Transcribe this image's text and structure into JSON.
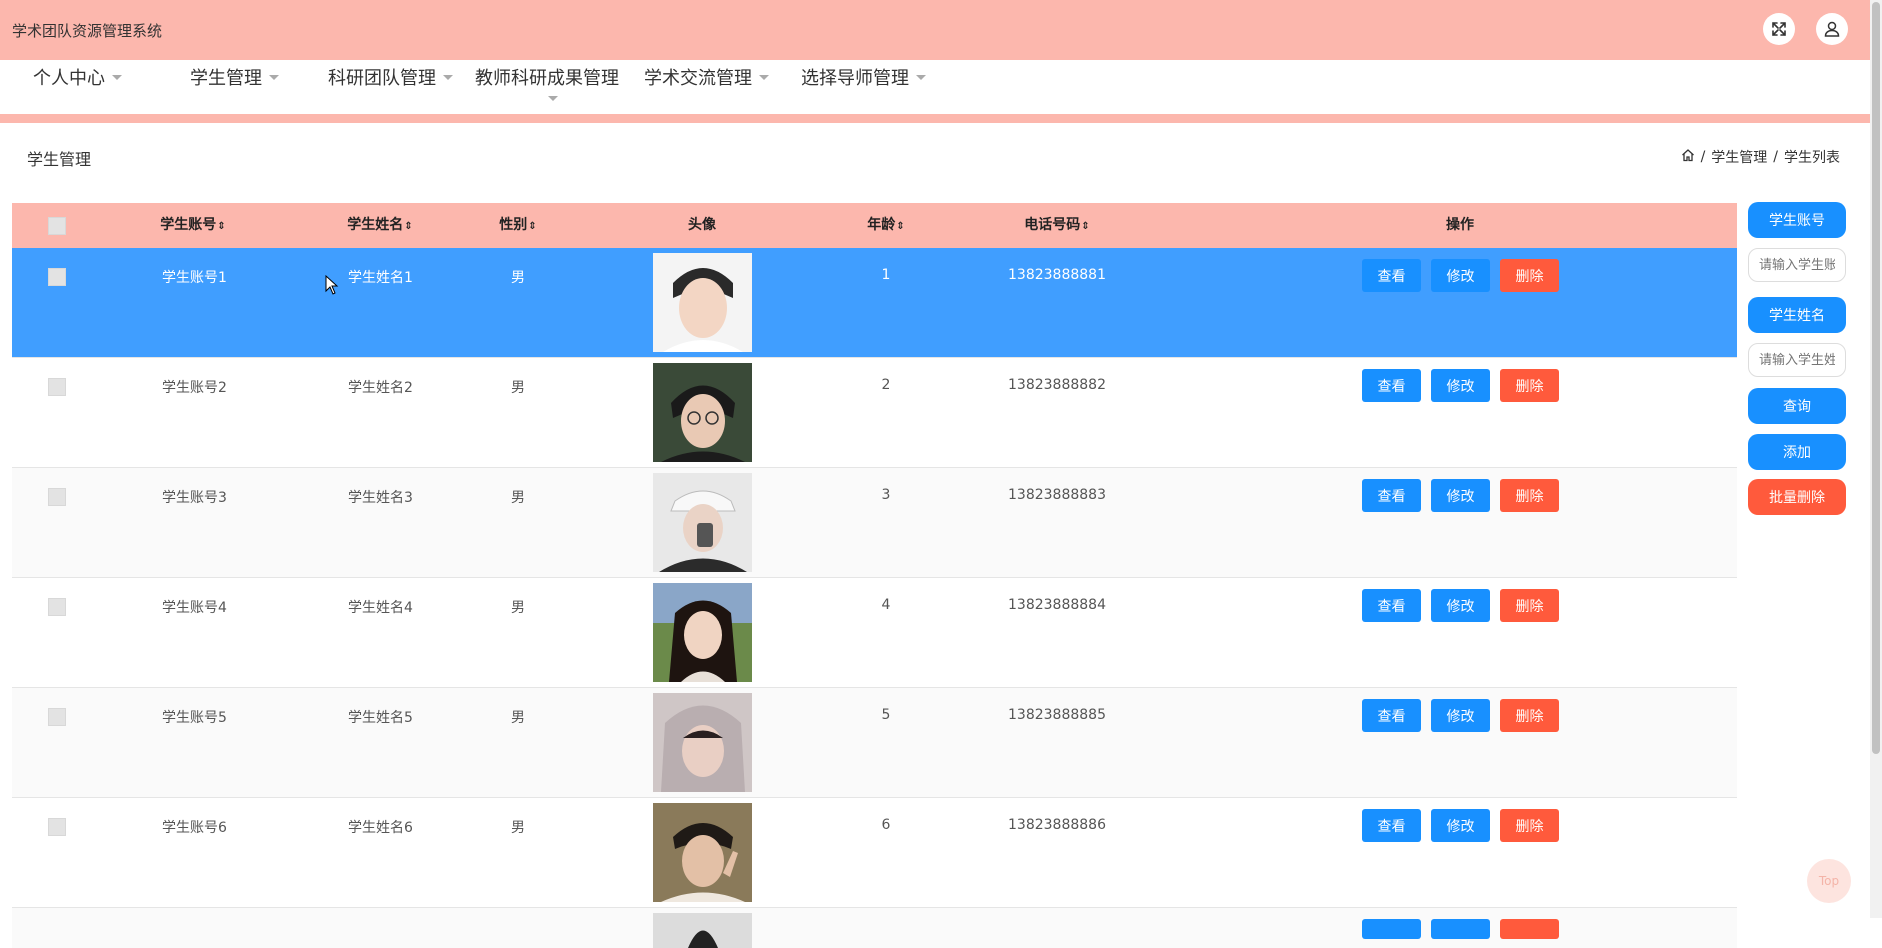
{
  "app": {
    "title": "学术团队资源管理系统",
    "fullscreen_icon": "fullscreen-icon",
    "user_icon": "user-icon"
  },
  "nav": {
    "items": [
      {
        "label": "个人中心"
      },
      {
        "label": "学生管理"
      },
      {
        "label": "科研团队管理"
      },
      {
        "label": "教师科研成果管理"
      },
      {
        "label": "学术交流管理"
      },
      {
        "label": "选择导师管理"
      }
    ]
  },
  "page": {
    "title": "学生管理",
    "breadcrumb": {
      "home_icon": "home-icon",
      "sep": "/",
      "level1": "学生管理",
      "level2": "学生列表"
    }
  },
  "table": {
    "headers": {
      "account": "学生账号",
      "name": "学生姓名",
      "gender": "性别",
      "avatar": "头像",
      "age": "年龄",
      "phone": "电话号码",
      "actions": "操作"
    },
    "sort_glyph": "⇕",
    "rows": [
      {
        "account": "学生账号1",
        "name": "学生姓名1",
        "gender": "男",
        "age": "1",
        "phone": "13823888881"
      },
      {
        "account": "学生账号2",
        "name": "学生姓名2",
        "gender": "男",
        "age": "2",
        "phone": "13823888882"
      },
      {
        "account": "学生账号3",
        "name": "学生姓名3",
        "gender": "男",
        "age": "3",
        "phone": "13823888883"
      },
      {
        "account": "学生账号4",
        "name": "学生姓名4",
        "gender": "男",
        "age": "4",
        "phone": "13823888884"
      },
      {
        "account": "学生账号5",
        "name": "学生姓名5",
        "gender": "男",
        "age": "5",
        "phone": "13823888885"
      },
      {
        "account": "学生账号6",
        "name": "学生姓名6",
        "gender": "男",
        "age": "6",
        "phone": "13823888886"
      }
    ],
    "selected_row": 1,
    "actions": {
      "view": "查看",
      "edit": "修改",
      "delete": "删除"
    }
  },
  "side": {
    "account_label": "学生账号",
    "account_placeholder": "请输入学生账号",
    "name_label": "学生姓名",
    "name_placeholder": "请输入学生姓名",
    "search": "查询",
    "add": "添加",
    "batch_delete": "批量删除"
  },
  "back_to_top": "Top",
  "colors": {
    "header_pink": "#fcb7ad",
    "primary_blue": "#1890ff",
    "selected_row_blue": "#409eff",
    "danger_red": "#ff5a3c"
  }
}
